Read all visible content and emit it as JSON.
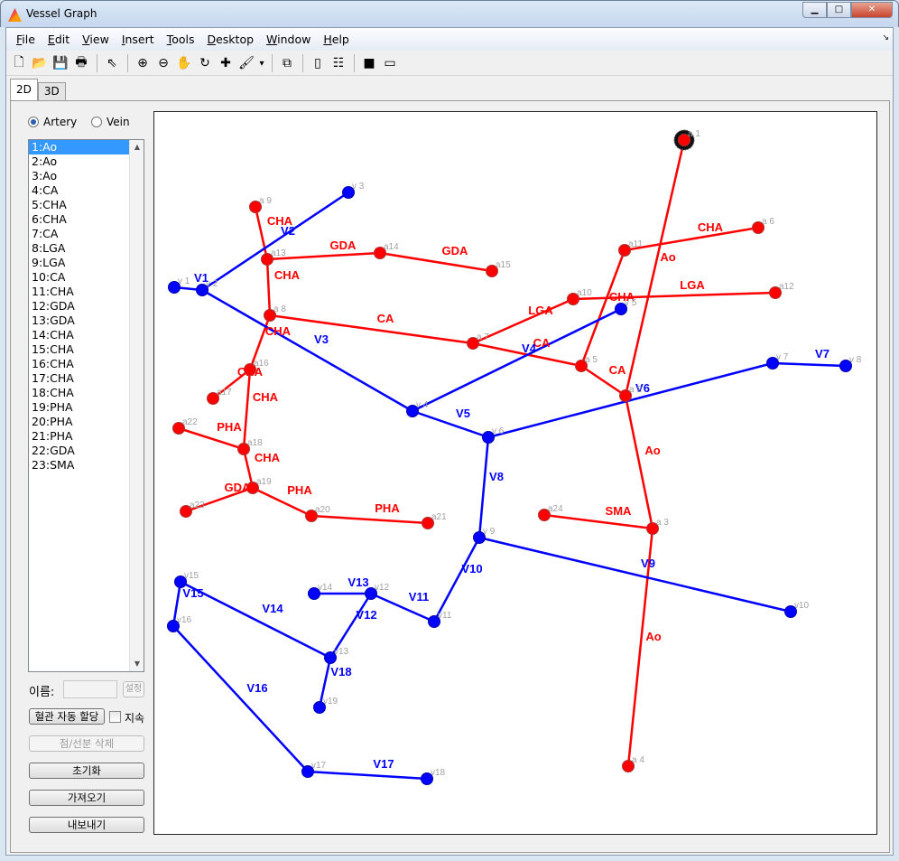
{
  "window": {
    "title": "Vessel Graph",
    "controls": [
      "minimize",
      "maximize",
      "close"
    ]
  },
  "menu": [
    {
      "key": "F",
      "rest": "ile"
    },
    {
      "key": "E",
      "rest": "dit"
    },
    {
      "key": "V",
      "rest": "iew"
    },
    {
      "key": "I",
      "rest": "nsert"
    },
    {
      "key": "T",
      "rest": "ools"
    },
    {
      "key": "D",
      "rest": "esktop"
    },
    {
      "key": "W",
      "rest": "indow"
    },
    {
      "key": "H",
      "rest": "elp"
    }
  ],
  "toolbar": [
    {
      "name": "new-file-icon",
      "glyph": "🗋"
    },
    {
      "name": "open-folder-icon",
      "glyph": "📂"
    },
    {
      "name": "save-icon",
      "glyph": "💾"
    },
    {
      "name": "print-icon",
      "glyph": "🖶"
    },
    {
      "sep": true
    },
    {
      "name": "pointer-icon",
      "glyph": "⇖"
    },
    {
      "sep": true
    },
    {
      "name": "zoom-in-icon",
      "glyph": "⊕"
    },
    {
      "name": "zoom-out-icon",
      "glyph": "⊖"
    },
    {
      "name": "pan-hand-icon",
      "glyph": "✋"
    },
    {
      "name": "rotate-3d-icon",
      "glyph": "↻"
    },
    {
      "name": "data-cursor-icon",
      "glyph": "✚"
    },
    {
      "name": "brush-icon",
      "glyph": "🖌"
    },
    {
      "name": "brush-dropdown-icon",
      "glyph": "▾"
    },
    {
      "sep": true
    },
    {
      "name": "link-plot-icon",
      "glyph": "⧉"
    },
    {
      "sep": true
    },
    {
      "name": "colorbar-icon",
      "glyph": "▯"
    },
    {
      "name": "legend-icon",
      "glyph": "☷"
    },
    {
      "sep": true
    },
    {
      "name": "hide-plot-tools-icon",
      "glyph": "■"
    },
    {
      "name": "show-plot-tools-icon",
      "glyph": "▭"
    }
  ],
  "tabs": [
    {
      "label": "2D",
      "active": true
    },
    {
      "label": "3D",
      "active": false
    }
  ],
  "vessel_type": {
    "options": [
      "Artery",
      "Vein"
    ],
    "selected": "Artery"
  },
  "list": {
    "items": [
      "1:Ao",
      "2:Ao",
      "3:Ao",
      "4:CA",
      "5:CHA",
      "6:CHA",
      "7:CA",
      "8:LGA",
      "9:LGA",
      "10:CA",
      "11:CHA",
      "12:GDA",
      "13:GDA",
      "14:CHA",
      "15:CHA",
      "16:CHA",
      "17:CHA",
      "18:CHA",
      "19:PHA",
      "20:PHA",
      "21:PHA",
      "22:GDA",
      "23:SMA"
    ],
    "selected_index": 0
  },
  "name_label": "이름:",
  "name_value": "",
  "set_button": "설정",
  "auto_assign_button": "혈관 자동 할당",
  "persist_checkbox": {
    "label": "지속",
    "checked": false
  },
  "delete_button": "점/선분 삭제",
  "reset_button": "초기화",
  "import_button": "가져오기",
  "export_button": "내보내기",
  "colors": {
    "artery": "#ff0000",
    "vein": "#0000ff",
    "node_label": "#a0a0a0",
    "selection": "#000000"
  },
  "graph": {
    "selected_node": "a1",
    "artery_nodes": [
      "a1",
      "a2",
      "a3",
      "a4",
      "a5",
      "a6",
      "a7",
      "a8",
      "a9",
      "a10",
      "a11",
      "a12",
      "a13",
      "a14",
      "a15",
      "a16",
      "a17",
      "a18",
      "a19",
      "a20",
      "a21",
      "a22",
      "a23",
      "a24"
    ],
    "artery_node_labels": {
      "a1": "a 1",
      "a2": "a 2",
      "a3": "a 3",
      "a4": "a 4",
      "a5": "a 5",
      "a6": "a 6",
      "a7": "a 7",
      "a8": "a 8",
      "a9": "a 9",
      "a10": "a10",
      "a11": "a11",
      "a12": "a12",
      "a13": "a13",
      "a14": "a14",
      "a15": "a15",
      "a16": "a16",
      "a17": "a17",
      "a18": "a18",
      "a19": "a19",
      "a20": "a20",
      "a21": "a21",
      "a22": "a22",
      "a23": "a23",
      "a24": "a24"
    },
    "artery_edges": [
      {
        "from": "a1",
        "to": "a2",
        "label": "Ao"
      },
      {
        "from": "a2",
        "to": "a3",
        "label": "Ao"
      },
      {
        "from": "a3",
        "to": "a4",
        "label": "Ao"
      },
      {
        "from": "a2",
        "to": "a5",
        "label": "CA"
      },
      {
        "from": "a5",
        "to": "a7",
        "label": "CA"
      },
      {
        "from": "a7",
        "to": "a8",
        "label": "CA"
      },
      {
        "from": "a7",
        "to": "a10",
        "label": "LGA"
      },
      {
        "from": "a10",
        "to": "a12",
        "label": "LGA"
      },
      {
        "from": "a5",
        "to": "a11",
        "label": "CHA"
      },
      {
        "from": "a11",
        "to": "a6",
        "label": "CHA"
      },
      {
        "from": "a8",
        "to": "a13",
        "label": "CHA"
      },
      {
        "from": "a13",
        "to": "a9",
        "label": "CHA"
      },
      {
        "from": "a13",
        "to": "a14",
        "label": "GDA"
      },
      {
        "from": "a14",
        "to": "a15",
        "label": "GDA"
      },
      {
        "from": "a8",
        "to": "a16",
        "label": "CHA"
      },
      {
        "from": "a16",
        "to": "a17",
        "label": "CHA"
      },
      {
        "from": "a16",
        "to": "a18",
        "label": "CHA"
      },
      {
        "from": "a18",
        "to": "a22",
        "label": "PHA"
      },
      {
        "from": "a18",
        "to": "a19",
        "label": "CHA"
      },
      {
        "from": "a19",
        "to": "a23",
        "label": "GDA"
      },
      {
        "from": "a19",
        "to": "a20",
        "label": "PHA"
      },
      {
        "from": "a20",
        "to": "a21",
        "label": "PHA"
      },
      {
        "from": "a3",
        "to": "a24",
        "label": "SMA"
      }
    ],
    "vein_nodes": [
      "v1",
      "v2",
      "v3",
      "v4",
      "v5",
      "v6",
      "v7",
      "v8",
      "v9",
      "v10",
      "v11",
      "v12",
      "v13",
      "v14",
      "v15",
      "v16",
      "v17",
      "v18",
      "v19"
    ],
    "vein_node_labels": {
      "v1": "v 1",
      "v2": "v 2",
      "v3": "v 3",
      "v4": "v 4",
      "v5": "v 5",
      "v6": "v 6",
      "v7": "v 7",
      "v8": "v 8",
      "v9": "v 9",
      "v10": "v10",
      "v11": "v11",
      "v12": "v12",
      "v13": "v13",
      "v14": "v14",
      "v15": "v15",
      "v16": "v16",
      "v17": "v17",
      "v18": "v18",
      "v19": "v19"
    },
    "vein_edges": [
      {
        "from": "v1",
        "to": "v2",
        "label": "V1"
      },
      {
        "from": "v2",
        "to": "v3",
        "label": "V2"
      },
      {
        "from": "v2",
        "to": "v4",
        "label": "V3"
      },
      {
        "from": "v4",
        "to": "v5",
        "label": "V4"
      },
      {
        "from": "v4",
        "to": "v6",
        "label": "V5"
      },
      {
        "from": "v6",
        "to": "v7",
        "label": "V6"
      },
      {
        "from": "v7",
        "to": "v8",
        "label": "V7"
      },
      {
        "from": "v6",
        "to": "v9",
        "label": "V8"
      },
      {
        "from": "v9",
        "to": "v10",
        "label": "V9"
      },
      {
        "from": "v9",
        "to": "v11",
        "label": "V10"
      },
      {
        "from": "v11",
        "to": "v12",
        "label": "V11"
      },
      {
        "from": "v12",
        "to": "v13",
        "label": "V12"
      },
      {
        "from": "v14",
        "to": "v12",
        "label": "V13"
      },
      {
        "from": "v13",
        "to": "v15",
        "label": "V14"
      },
      {
        "from": "v15",
        "to": "v16",
        "label": "V15"
      },
      {
        "from": "v16",
        "to": "v17",
        "label": "V16"
      },
      {
        "from": "v17",
        "to": "v18",
        "label": "V17"
      },
      {
        "from": "v13",
        "to": "v19",
        "label": "V18"
      }
    ]
  }
}
